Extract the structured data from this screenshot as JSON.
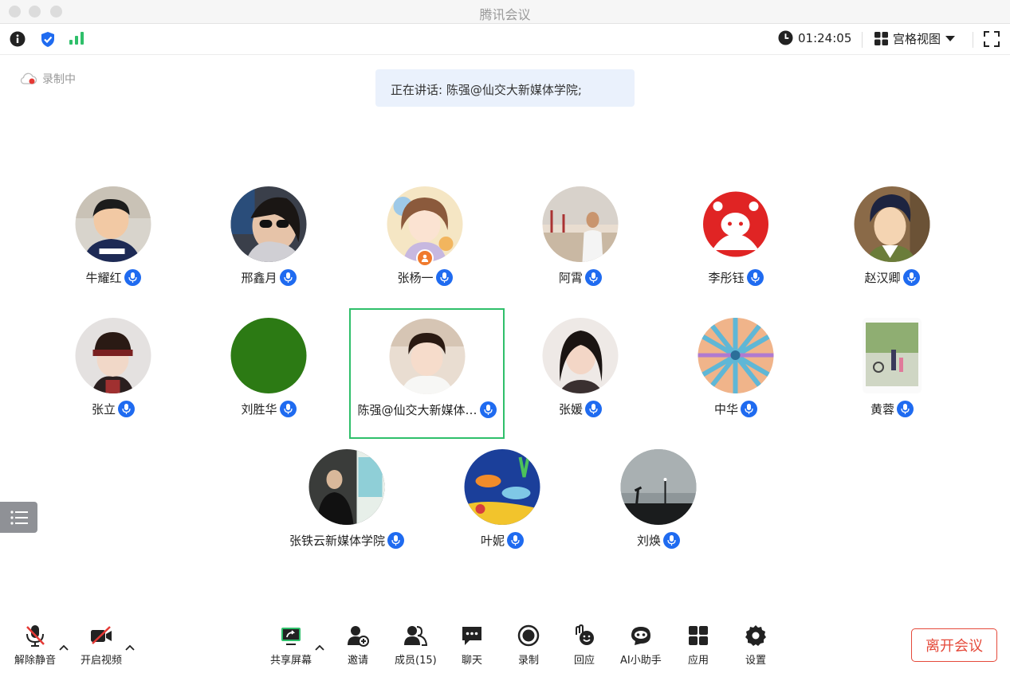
{
  "window": {
    "title": "腾讯会议"
  },
  "topbar": {
    "timer": "01:24:05",
    "view_label": "宫格视图"
  },
  "status": {
    "recording": "录制中",
    "speaking": "正在讲话: 陈强@仙交大新媒体学院;"
  },
  "participants": [
    {
      "name": "牛耀红"
    },
    {
      "name": "邢鑫月"
    },
    {
      "name": "张杨一"
    },
    {
      "name": "阿霄"
    },
    {
      "name": "李彤钰"
    },
    {
      "name": "赵汉卿"
    },
    {
      "name": "张立"
    },
    {
      "name": "刘胜华"
    },
    {
      "name": "陈强@仙交大新媒体…"
    },
    {
      "name": "张媛"
    },
    {
      "name": "中华"
    },
    {
      "name": "黄蓉"
    },
    {
      "name": "张铁云新媒体学院"
    },
    {
      "name": "叶妮"
    },
    {
      "name": "刘焕"
    }
  ],
  "bottombar": {
    "unmute": "解除静音",
    "start_video": "开启视频",
    "share_screen": "共享屏幕",
    "invite": "邀请",
    "members": "成员(15)",
    "chat": "聊天",
    "record": "录制",
    "react": "回应",
    "ai_assistant": "AI小助手",
    "apps": "应用",
    "settings": "设置",
    "leave": "离开会议"
  },
  "colors": {
    "accent_blue": "#1f6bf0",
    "leave_red": "#e5493a",
    "active_green": "#2fbf6a",
    "speaking_bg": "#eaf1fc"
  }
}
